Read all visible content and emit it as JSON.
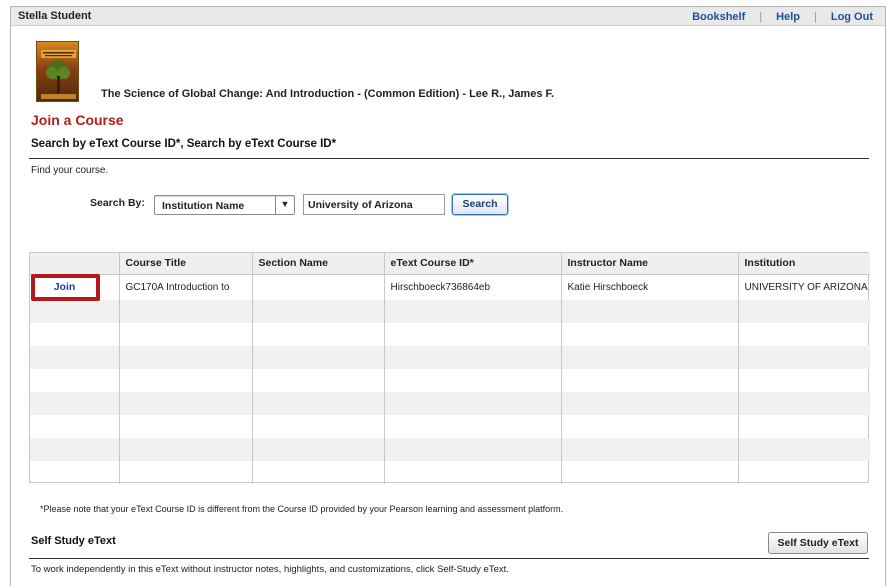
{
  "header": {
    "user_name": "Stella Student",
    "nav": [
      {
        "label": "Bookshelf"
      },
      {
        "label": "Help"
      },
      {
        "label": "Log Out"
      }
    ],
    "separator": "|"
  },
  "book": {
    "title": "The Science of Global Change: And Introduction - (Common Edition) - Lee R., James F.",
    "cover_icon": "book-cover-tree"
  },
  "page": {
    "title": "Join a Course",
    "section_heading": "Search by eText Course ID*, Search by eText Course ID*",
    "instruction": "Find your course."
  },
  "search": {
    "label": "Search By:",
    "select_value": "Institution Name",
    "input_value": "University of Arizona",
    "button_label": "Search"
  },
  "results": {
    "columns": [
      "",
      "Course Title",
      "Section Name",
      "eText Course ID*",
      "Instructor Name",
      "Institution"
    ],
    "rows": [
      {
        "action": "Join",
        "course_title": "GC170A Introduction to",
        "section_name": "",
        "etext_course_id": "Hirschboeck736864eb",
        "instructor_name": "Katie Hirschboeck",
        "institution": "UNIVERSITY OF ARIZONA"
      }
    ],
    "highlight_color": "#b3191c"
  },
  "note": "*Please note that your eText Course ID is different from the Course ID provided by your Pearson learning and assessment platform.",
  "self_study": {
    "heading": "Self Study eText",
    "button_label": "Self Study eText",
    "description": "To work independently in this eText without instructor notes, highlights, and customizations, click Self-Study eText."
  },
  "colors": {
    "accent_title": "#b0201a",
    "link": "#1f4f9a",
    "join_link": "#1f3fa0"
  }
}
